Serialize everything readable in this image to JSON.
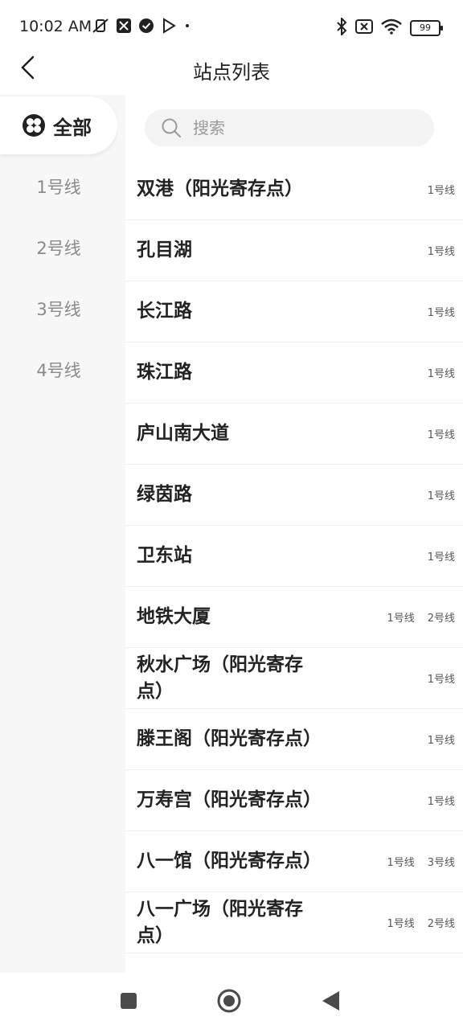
{
  "status_bar": {
    "time": "10:02 AM",
    "battery": "99"
  },
  "header": {
    "title": "站点列表"
  },
  "sidebar": {
    "items": [
      {
        "label": "全部",
        "icon": "all-grid-icon",
        "active": true
      },
      {
        "label": "1号线",
        "active": false
      },
      {
        "label": "2号线",
        "active": false
      },
      {
        "label": "3号线",
        "active": false
      },
      {
        "label": "4号线",
        "active": false
      }
    ]
  },
  "search": {
    "placeholder": "搜索",
    "value": ""
  },
  "stations": [
    {
      "name": "双港（阳光寄存点）",
      "lines": [
        "1号线"
      ]
    },
    {
      "name": "孔目湖",
      "lines": [
        "1号线"
      ]
    },
    {
      "name": "长江路",
      "lines": [
        "1号线"
      ]
    },
    {
      "name": "珠江路",
      "lines": [
        "1号线"
      ]
    },
    {
      "name": "庐山南大道",
      "lines": [
        "1号线"
      ]
    },
    {
      "name": "绿茵路",
      "lines": [
        "1号线"
      ]
    },
    {
      "name": "卫东站",
      "lines": [
        "1号线"
      ]
    },
    {
      "name": "地铁大厦",
      "lines": [
        "1号线",
        "2号线"
      ]
    },
    {
      "name": "秋水广场（阳光寄存点）",
      "lines": [
        "1号线"
      ]
    },
    {
      "name": "滕王阁（阳光寄存点）",
      "lines": [
        "1号线"
      ]
    },
    {
      "name": "万寿宫（阳光寄存点）",
      "lines": [
        "1号线"
      ]
    },
    {
      "name": "八一馆（阳光寄存点）",
      "lines": [
        "1号线",
        "3号线"
      ]
    },
    {
      "name": "八一广场（阳光寄存点）",
      "lines": [
        "1号线",
        "2号线"
      ]
    }
  ],
  "colors": {
    "text": "#222222",
    "sidebar_bg": "#f7f7f7",
    "muted": "#8a8a8a"
  }
}
